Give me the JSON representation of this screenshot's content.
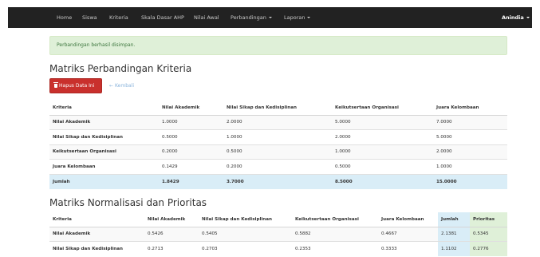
{
  "navbar": {
    "items": [
      {
        "label": "Home"
      },
      {
        "label": "Siswa"
      },
      {
        "label": "Kriteria"
      },
      {
        "label": "Skala Dasar AHP"
      },
      {
        "label": "Nilai Awal"
      },
      {
        "label": "Perbandingan"
      },
      {
        "label": "Laporan"
      }
    ],
    "user": "Anindia"
  },
  "alert": {
    "message": "Perbandingan berhasil disimpan."
  },
  "section1": {
    "title": "Matriks Perbandingan Kriteria",
    "delete_label": "Hapus Data Ini",
    "back_label": "Kembali",
    "headers": [
      "Kriteria",
      "Nilai Akademik",
      "Nilai Sikap dan Kedisiplinan",
      "Keikutsertaan Organisasi",
      "Juara Kelombaan"
    ],
    "rows": [
      [
        "Nilai Akademik",
        "1.0000",
        "2.0000",
        "5.0000",
        "7.0000"
      ],
      [
        "Nilai Sikap dan Kedisiplinan",
        "0.5000",
        "1.0000",
        "2.0000",
        "5.0000"
      ],
      [
        "Keikutsertaan Organisasi",
        "0.2000",
        "0.5000",
        "1.0000",
        "2.0000"
      ],
      [
        "Juara Kelombaan",
        "0.1429",
        "0.2000",
        "0.5000",
        "1.0000"
      ]
    ],
    "total": [
      "Jumlah",
      "1.8429",
      "3.7000",
      "8.5000",
      "15.0000"
    ]
  },
  "section2": {
    "title": "Matriks Normalisasi dan Prioritas",
    "headers": [
      "Kriteria",
      "Nilai Akademik",
      "Nilai Sikap dan Kedisiplinan",
      "Keikutsertaan Organisasi",
      "Juara Kelombaan",
      "Jumlah",
      "Prioritas"
    ],
    "rows": [
      [
        "Nilai Akademik",
        "0.5426",
        "0.5405",
        "0.5882",
        "0.4667",
        "2.1381",
        "0.5345"
      ],
      [
        "Nilai Sikap dan Kedisiplinan",
        "0.2713",
        "0.2703",
        "0.2353",
        "0.3333",
        "1.1102",
        "0.2776"
      ]
    ]
  },
  "colors": {
    "navbar": "#222222",
    "danger": "#c9302c",
    "info_row": "#d9edf7",
    "success_cell": "#dff0d8"
  },
  "icons": [
    "trash-icon",
    "arrow-left-icon",
    "caret-down-icon"
  ]
}
